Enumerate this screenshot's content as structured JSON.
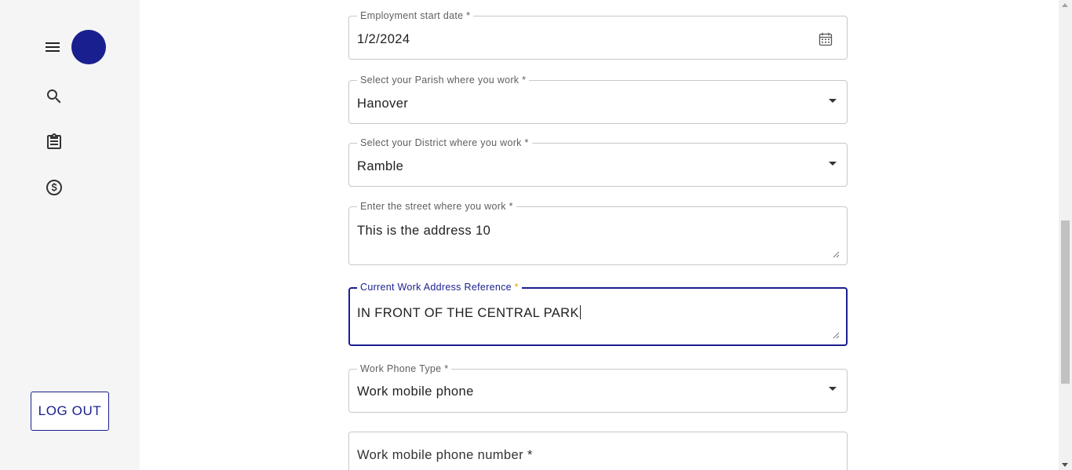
{
  "sidebar": {
    "icons": [
      "menu-icon",
      "search-icon",
      "clipboard-icon",
      "dollar-circle-icon"
    ],
    "logout_label": "LOG OUT",
    "accent_color": "#1a1f8f"
  },
  "form": {
    "employment_start_date": {
      "label": "Employment start date",
      "required": "*",
      "value": "1/2/2024",
      "icon": "calendar-icon"
    },
    "parish": {
      "label": "Select your Parish where you work",
      "required": "*",
      "value": "Hanover"
    },
    "district": {
      "label": "Select your District where you work",
      "required": "*",
      "value": "Ramble"
    },
    "street": {
      "label": "Enter the street where you work",
      "required": "*",
      "value": "This is the address 10"
    },
    "address_reference": {
      "label": "Current Work Address Reference",
      "required": "*",
      "value": "IN FRONT OF THE CENTRAL PARK"
    },
    "phone_type": {
      "label": "Work Phone Type",
      "required": "*",
      "value": "Work mobile phone"
    },
    "phone_number": {
      "placeholder": "Work mobile phone number *"
    }
  }
}
